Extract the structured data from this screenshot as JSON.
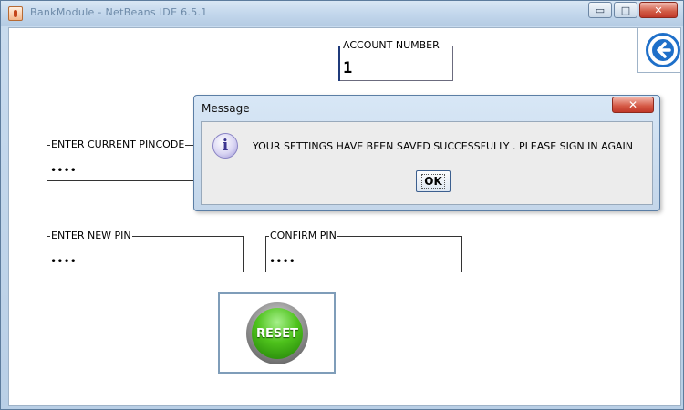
{
  "window": {
    "title": "BankModule - NetBeans IDE 6.5.1",
    "min_label": "▭",
    "max_label": "□",
    "close_label": "✕"
  },
  "form": {
    "account_number": {
      "label": "ACCOUNT NUMBER",
      "value": "1"
    },
    "current_pincode": {
      "label": "ENTER CURRENT PINCODE",
      "value": "••••"
    },
    "new_pin": {
      "label": "ENTER NEW PIN",
      "value": "••••"
    },
    "confirm_pin": {
      "label": "CONFIRM PIN",
      "value": "••••"
    },
    "reset_label": "RESET"
  },
  "dialog": {
    "title": "Message",
    "close_label": "✕",
    "message": "YOUR SETTINGS HAVE BEEN SAVED SUCCESSFULLY . PLEASE SIGN IN AGAIN",
    "ok_label": "OK"
  },
  "icons": {
    "info": "i",
    "back": "arrow-left-icon"
  },
  "colors": {
    "accent": "#1e6fc9",
    "reset_green": "#4ec21c",
    "close_red": "#c0392b"
  }
}
